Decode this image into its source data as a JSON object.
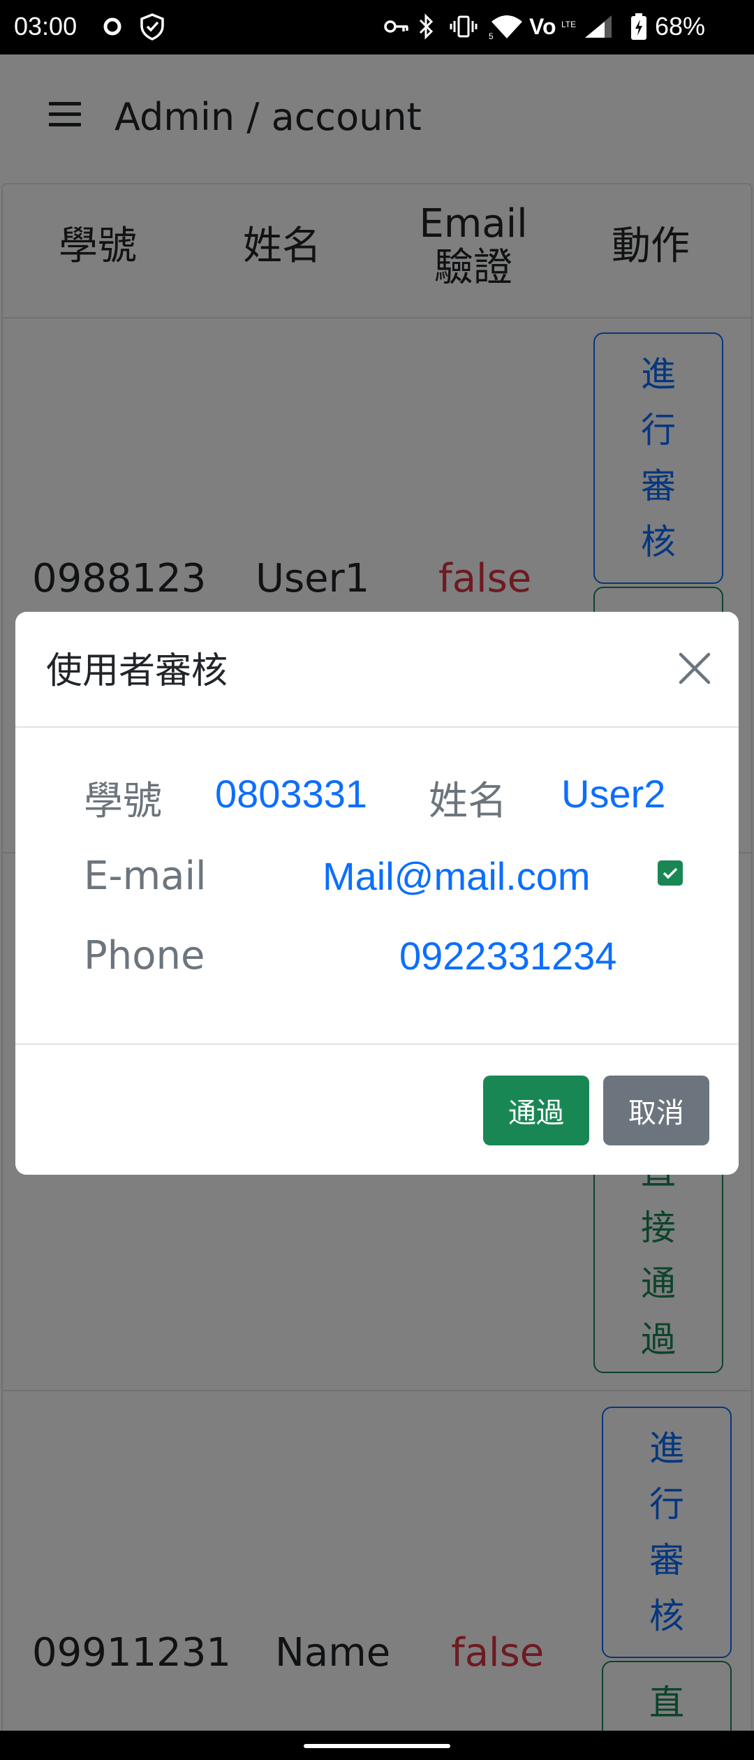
{
  "status_bar": {
    "time": "03:00",
    "battery_pct": "68%",
    "icons": [
      "circle-icon",
      "shield-icon",
      "key-icon",
      "bluetooth-icon",
      "vibrate-icon",
      "wifi-icon",
      "volte-icon",
      "signal-icon",
      "battery-icon"
    ]
  },
  "app_bar": {
    "title": "Admin / account",
    "menu_icon": "menu-icon"
  },
  "table": {
    "headers": {
      "student_id": "學號",
      "name": "姓名",
      "email_verified_1": "Email",
      "email_verified_2": "驗證",
      "action": "動作"
    },
    "rows": [
      {
        "student_id": "0988123",
        "name": "User1",
        "email_verified": "false",
        "review_btn": [
          "進",
          "行",
          "審",
          "核"
        ]
      },
      {
        "approve_btn": [
          "直",
          "接",
          "通",
          "過"
        ]
      },
      {
        "student_id": "09911231",
        "name": "Name",
        "email_verified": "false",
        "review_btn": [
          "進",
          "行",
          "審",
          "核"
        ],
        "approve_btn_visible": [
          "直"
        ]
      }
    ]
  },
  "modal": {
    "title": "使用者審核",
    "close_icon": "close-icon",
    "student_id_label": "學號",
    "student_id_value": "0803331",
    "name_label": "姓名",
    "name_value": "User2",
    "email_label": "E-mail",
    "email_value": "Mail@mail.com",
    "email_verified_checked": true,
    "phone_label": "Phone",
    "phone_value": "0922331234",
    "approve_label": "通過",
    "cancel_label": "取消"
  },
  "colors": {
    "primary": "#0d6efd",
    "success": "#198754",
    "danger": "#dc3545",
    "secondary": "#6c757d"
  }
}
